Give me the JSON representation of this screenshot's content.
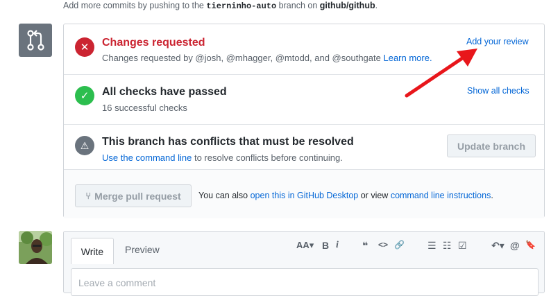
{
  "note": {
    "prefix": "Add more commits by pushing to the",
    "branch": "tierninho-auto",
    "middle": "branch on",
    "repo": "github/github",
    "suffix": "."
  },
  "review": {
    "title": "Changes requested",
    "subtitle": "Changes requested by @josh, @mhagger, @mtodd, and @southgate",
    "learn_more": "Learn more.",
    "action": "Add your review"
  },
  "checks": {
    "title": "All checks have passed",
    "subtitle": "16 successful checks",
    "action": "Show all checks"
  },
  "conflicts": {
    "title": "This branch has conflicts that must be resolved",
    "link": "Use the command line",
    "subtitle_rest": "to resolve conflicts before continuing.",
    "button": "Update branch"
  },
  "merge": {
    "button": "Merge pull request",
    "text_prefix": "You can also",
    "desktop_link": "open this in GitHub Desktop",
    "text_middle": "or view",
    "cli_link": "command line instructions",
    "text_suffix": "."
  },
  "comment": {
    "tab_write": "Write",
    "tab_preview": "Preview",
    "placeholder": "Leave a comment",
    "toolbar": [
      "AA▾",
      "B",
      "i",
      "❝",
      "<>",
      "🔗",
      "☰",
      "☷",
      "☑",
      "↶▾",
      "@",
      "🔖"
    ]
  },
  "colors": {
    "red": "#cb2431",
    "green": "#2cbe4e",
    "link": "#0366d6",
    "arrow": "#e8161b"
  }
}
